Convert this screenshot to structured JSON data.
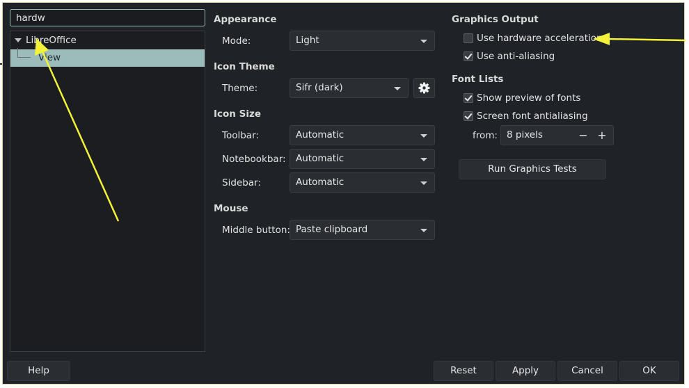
{
  "search": {
    "value": "hardw"
  },
  "tree": {
    "root": "LibreOffice",
    "child": "View"
  },
  "appearance": {
    "title": "Appearance",
    "mode_label": "Mode:",
    "mode_value": "Light"
  },
  "icon_theme": {
    "title": "Icon Theme",
    "theme_label": "Theme:",
    "theme_value": "Sifr (dark)",
    "settings_icon": "gear-icon"
  },
  "icon_size": {
    "title": "Icon Size",
    "toolbar_label": "Toolbar:",
    "toolbar_value": "Automatic",
    "notebookbar_label": "Notebookbar:",
    "notebookbar_value": "Automatic",
    "sidebar_label": "Sidebar:",
    "sidebar_value": "Automatic"
  },
  "mouse": {
    "title": "Mouse",
    "middle_label": "Middle button:",
    "middle_value": "Paste clipboard"
  },
  "graphics_output": {
    "title": "Graphics Output",
    "hw_accel_label": "Use hardware acceleration",
    "hw_accel_checked": false,
    "anti_alias_label": "Use anti-aliasing",
    "anti_alias_checked": true
  },
  "font_lists": {
    "title": "Font Lists",
    "preview_label": "Show preview of fonts",
    "preview_checked": true,
    "screen_aa_label": "Screen font antialiasing",
    "screen_aa_checked": true,
    "from_label": "from:",
    "from_value": "8 pixels",
    "minus": "−",
    "plus": "+"
  },
  "run_tests_label": "Run Graphics Tests",
  "footer": {
    "help": "Help",
    "reset": "Reset",
    "apply": "Apply",
    "cancel": "Cancel",
    "ok": "OK"
  },
  "colors": {
    "dialog_bg": "#1f2226",
    "selection": "#9cbcbc",
    "annotation_arrow": "#f2f23a"
  }
}
